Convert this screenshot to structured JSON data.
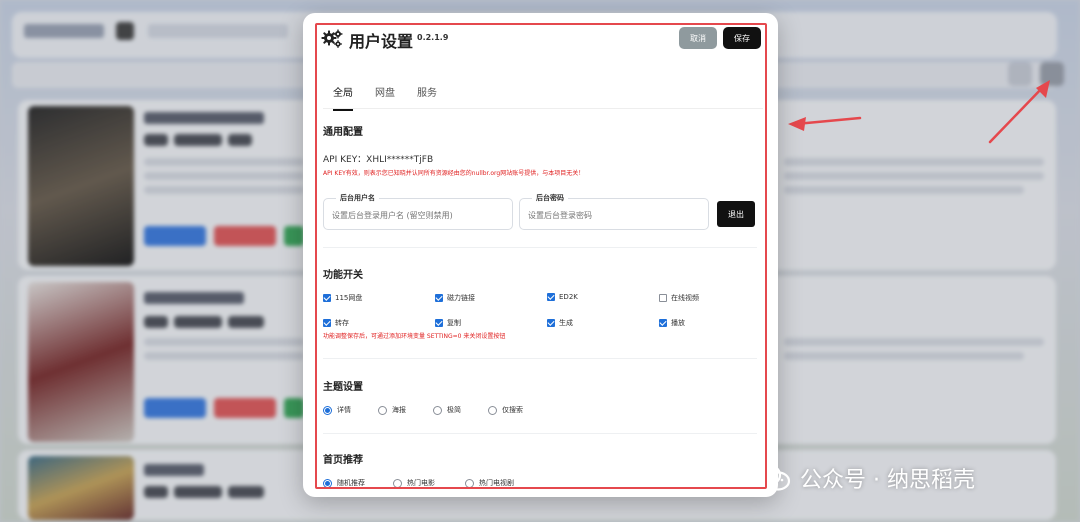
{
  "modal": {
    "title": "用户设置",
    "version": "0.2.1.9",
    "cancel_label": "取消",
    "save_label": "保存"
  },
  "tabs": [
    {
      "label": "全局",
      "active": true
    },
    {
      "label": "网盘",
      "active": false
    },
    {
      "label": "服务",
      "active": false
    }
  ],
  "general": {
    "title": "通用配置",
    "api_key": "API KEY：XHLI******TjFB",
    "api_note": "API KEY有效，则表示您已知晓并认同所有资源经由您的nullbr.org网站账号提供，与本项目无关！",
    "username_label": "后台用户名",
    "username_placeholder": "设置后台登录用户名 (留空则禁用)",
    "password_label": "后台密码",
    "password_placeholder": "设置后台登录密码",
    "logout_label": "退出"
  },
  "features": {
    "title": "功能开关",
    "items": [
      {
        "label": "115网盘",
        "checked": true
      },
      {
        "label": "磁力链接",
        "checked": true
      },
      {
        "label": "ED2K",
        "checked": true
      },
      {
        "label": "在线视频",
        "checked": false
      },
      {
        "label": "转存",
        "checked": true
      },
      {
        "label": "复制",
        "checked": true
      },
      {
        "label": "生成",
        "checked": true
      },
      {
        "label": "播放",
        "checked": true
      }
    ],
    "note": "功能调整保存后，可通过添加环境变量 SETTING=0 来关闭设置按钮"
  },
  "theme": {
    "title": "主题设置",
    "options": [
      {
        "label": "详情",
        "selected": true
      },
      {
        "label": "海报",
        "selected": false
      },
      {
        "label": "极简",
        "selected": false
      },
      {
        "label": "仅搜索",
        "selected": false
      }
    ]
  },
  "home": {
    "title": "首页推荐",
    "options": [
      {
        "label": "随机推荐",
        "selected": true
      },
      {
        "label": "热门电影",
        "selected": false
      },
      {
        "label": "热门电视剧",
        "selected": false
      }
    ]
  },
  "watermark": {
    "text": "公众号 · 纳思稻壳"
  },
  "colors": {
    "accent": "#1e6fd9",
    "annotation_red": "#e5484d",
    "warning_text": "#e02020"
  }
}
